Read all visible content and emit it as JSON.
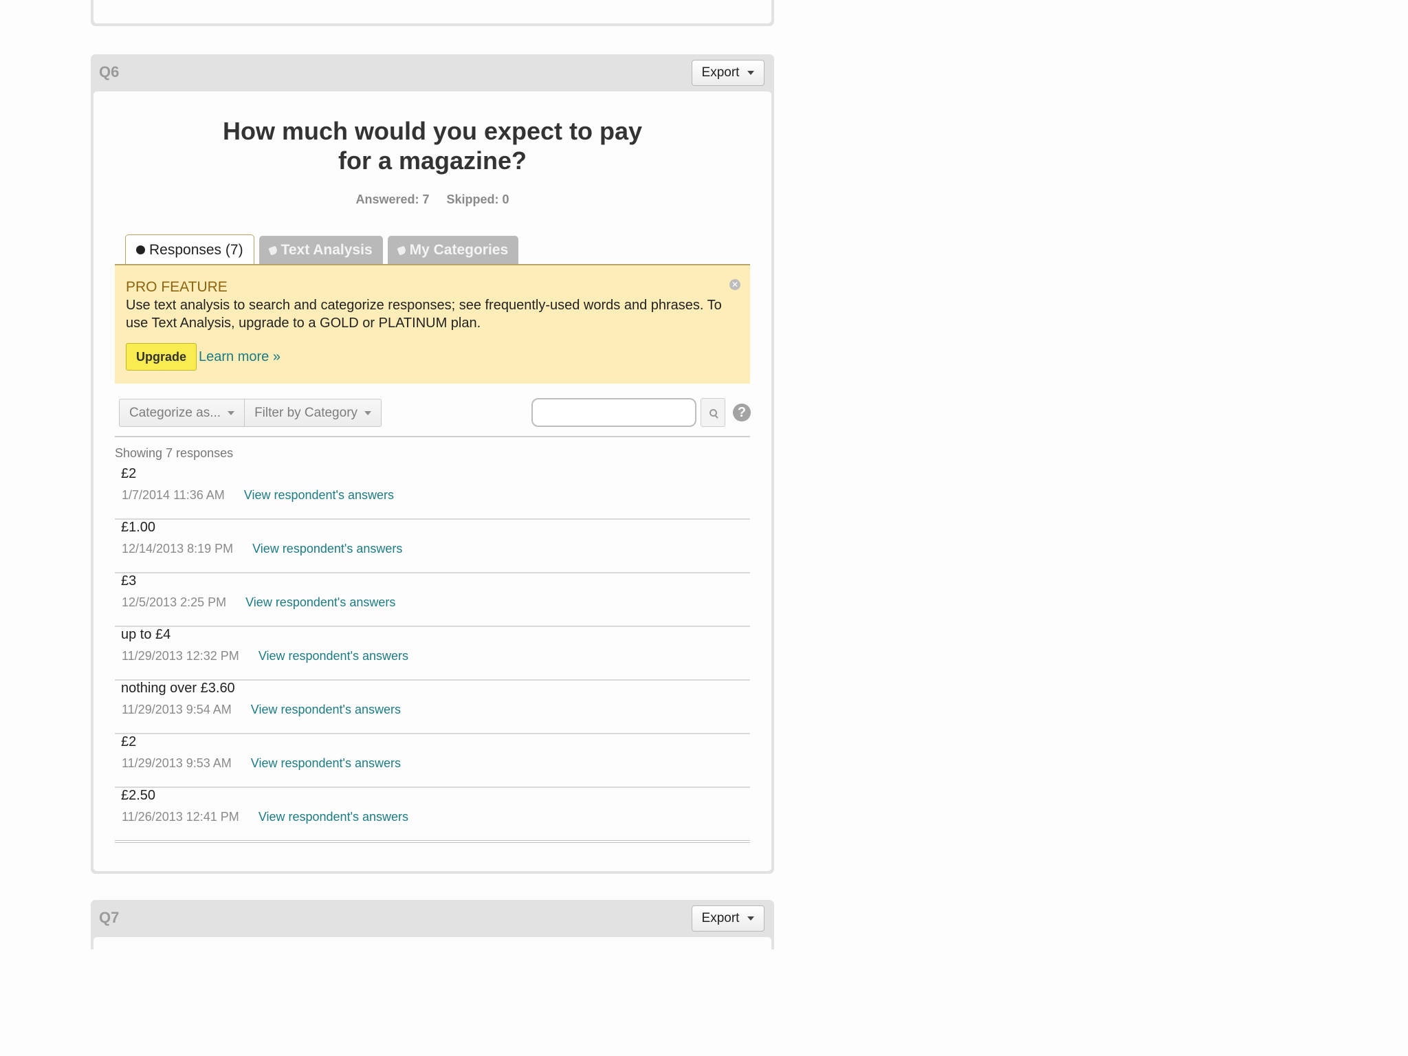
{
  "q6": {
    "number": "Q6",
    "export_label": "Export",
    "title": "How much would you expect to pay for a magazine?",
    "answered": "Answered: 7",
    "skipped": "Skipped: 0",
    "tabs": [
      {
        "label": "Responses (7)"
      },
      {
        "label": "Text Analysis"
      },
      {
        "label": "My Categories"
      }
    ],
    "promo": {
      "title": "PRO FEATURE",
      "text": "Use text analysis to search and categorize responses; see frequently-used words and phrases. To use Text Analysis, upgrade to a GOLD or PLATINUM plan.",
      "upgrade_label": "Upgrade",
      "learn_more_label": "Learn more »"
    },
    "toolbar": {
      "categorize_label": "Categorize as...",
      "filter_label": "Filter by Category",
      "search_placeholder": "",
      "help_label": "?"
    },
    "showing": "Showing 7 responses",
    "responses": [
      {
        "text": "£2",
        "date": "1/7/2014 11:36 AM",
        "link": "View respondent's answers"
      },
      {
        "text": "£1.00",
        "date": "12/14/2013 8:19 PM",
        "link": "View respondent's answers"
      },
      {
        "text": "£3",
        "date": "12/5/2013 2:25 PM",
        "link": "View respondent's answers"
      },
      {
        "text": "up to £4",
        "date": "11/29/2013 12:32 PM",
        "link": "View respondent's answers"
      },
      {
        "text": "nothing over £3.60",
        "date": "11/29/2013 9:54 AM",
        "link": "View respondent's answers"
      },
      {
        "text": "£2",
        "date": "11/29/2013 9:53 AM",
        "link": "View respondent's answers"
      },
      {
        "text": "£2.50",
        "date": "11/26/2013 12:41 PM",
        "link": "View respondent's answers"
      }
    ]
  },
  "q7": {
    "number": "Q7",
    "export_label": "Export"
  },
  "colors": {
    "link": "#1d7b84",
    "promo_bg": "#fdedb8",
    "upgrade_bg": "#f8ec50",
    "card_frame": "#e2e2e2"
  }
}
